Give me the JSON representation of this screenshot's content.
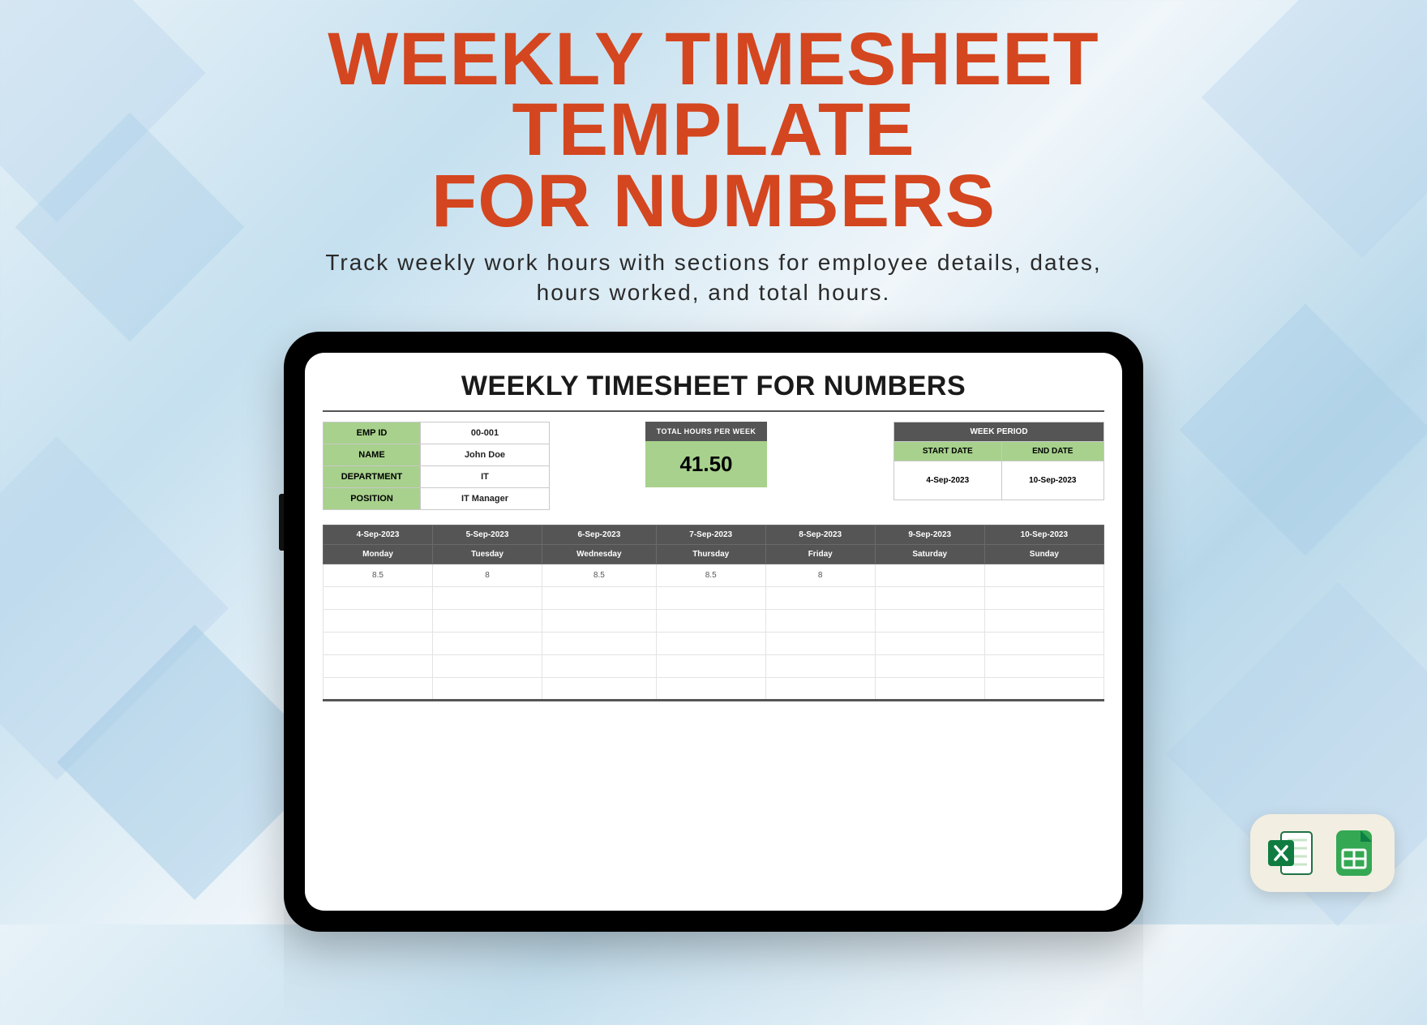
{
  "hero": {
    "title_line1": "WEEKLY TIMESHEET",
    "title_line2": "TEMPLATE",
    "title_line3": "FOR NUMBERS",
    "subtitle_line1": "Track weekly work hours with sections for employee details, dates,",
    "subtitle_line2": "hours worked, and total hours."
  },
  "sheet": {
    "title": "WEEKLY TIMESHEET FOR NUMBERS",
    "employee": {
      "emp_id_label": "EMP ID",
      "emp_id_value": "00-001",
      "name_label": "NAME",
      "name_value": "John Doe",
      "dept_label": "DEPARTMENT",
      "dept_value": "IT",
      "pos_label": "POSITION",
      "pos_value": "IT Manager"
    },
    "total": {
      "label": "TOTAL  HOURS PER WEEK",
      "value": "41.50"
    },
    "period": {
      "header": "WEEK PERIOD",
      "start_label": "START DATE",
      "end_label": "END DATE",
      "start_value": "4-Sep-2023",
      "end_value": "10-Sep-2023"
    },
    "columns": [
      {
        "date": "4-Sep-2023",
        "day": "Monday",
        "hours": "8.5"
      },
      {
        "date": "5-Sep-2023",
        "day": "Tuesday",
        "hours": "8"
      },
      {
        "date": "6-Sep-2023",
        "day": "Wednesday",
        "hours": "8.5"
      },
      {
        "date": "7-Sep-2023",
        "day": "Thursday",
        "hours": "8.5"
      },
      {
        "date": "8-Sep-2023",
        "day": "Friday",
        "hours": "8"
      },
      {
        "date": "9-Sep-2023",
        "day": "Saturday",
        "hours": ""
      },
      {
        "date": "10-Sep-2023",
        "day": "Sunday",
        "hours": ""
      }
    ]
  },
  "chart_data": {
    "type": "table",
    "title": "WEEKLY TIMESHEET FOR NUMBERS",
    "categories": [
      "4-Sep-2023",
      "5-Sep-2023",
      "6-Sep-2023",
      "7-Sep-2023",
      "8-Sep-2023",
      "9-Sep-2023",
      "10-Sep-2023"
    ],
    "days": [
      "Monday",
      "Tuesday",
      "Wednesday",
      "Thursday",
      "Friday",
      "Saturday",
      "Sunday"
    ],
    "values": [
      8.5,
      8,
      8.5,
      8.5,
      8,
      null,
      null
    ],
    "total": 41.5,
    "employee": {
      "id": "00-001",
      "name": "John Doe",
      "department": "IT",
      "position": "IT Manager"
    },
    "period": {
      "start": "4-Sep-2023",
      "end": "10-Sep-2023"
    }
  }
}
